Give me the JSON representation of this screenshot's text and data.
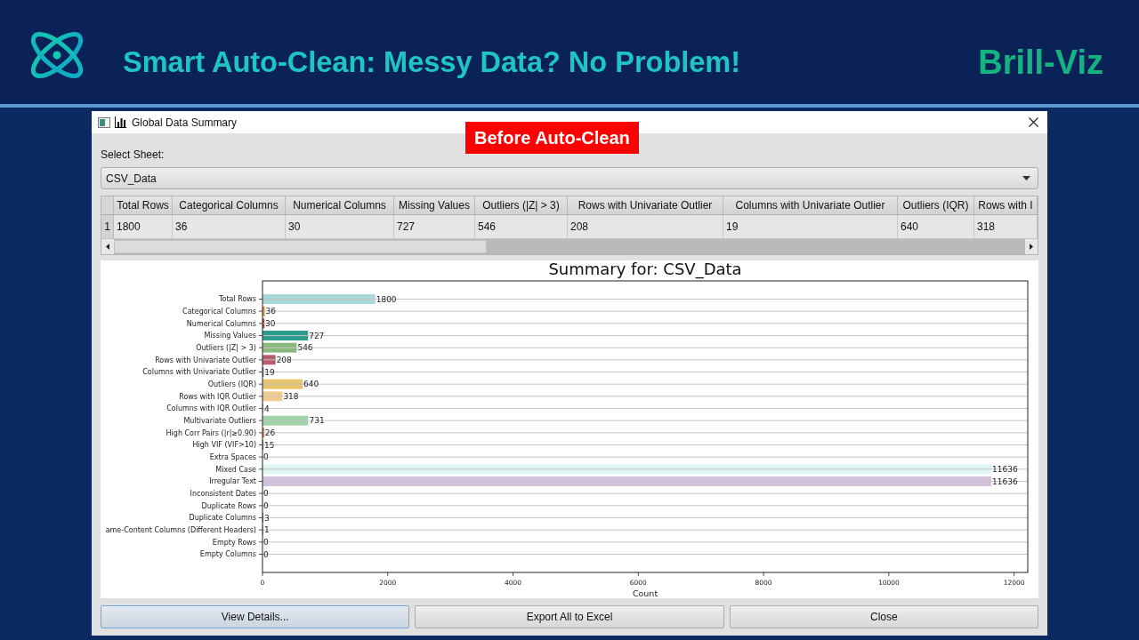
{
  "header": {
    "title": "Smart Auto-Clean: Messy Data? No Problem!",
    "brand": "Brill-Viz"
  },
  "badge": {
    "text": "Before Auto-Clean"
  },
  "dialog": {
    "title": "Global Data Summary",
    "sheet_label": "Select Sheet:",
    "sheet": {
      "value": "CSV_Data"
    },
    "table": {
      "columns": [
        "Total Rows",
        "Categorical Columns",
        "Numerical Columns",
        "Missing Values",
        "Outliers (|Z| > 3)",
        "Rows with Univariate Outlier",
        "Columns with Univariate Outlier",
        "Outliers (IQR)",
        "Rows with I"
      ],
      "rows": [
        {
          "header": "1",
          "cells": [
            "1800",
            "36",
            "30",
            "727",
            "546",
            "208",
            "19",
            "640",
            "318"
          ]
        }
      ]
    },
    "chart": {
      "chart_data": {
        "type": "bar",
        "orientation": "horizontal",
        "title": "Summary for: CSV_Data",
        "xlabel": "Count",
        "categories": [
          "Total Rows",
          "Categorical Columns",
          "Numerical Columns",
          "Missing Values",
          "Outliers (|Z| > 3)",
          "Rows with Univariate Outlier",
          "Columns with Univariate Outlier",
          "Outliers (IQR)",
          "Rows with IQR Outlier",
          "Columns with IQR Outlier",
          "Multivariate Outliers",
          "High Corr Pairs (|r|≥0.90)",
          "High VIF (VIF>10)",
          "Extra Spaces",
          "Mixed Case",
          "Irregular Text",
          "Inconsistent Dates",
          "Duplicate Rows",
          "Duplicate Columns",
          "ame-Content Columns (Different Headers)",
          "Empty Rows",
          "Empty Columns"
        ],
        "series": [
          {
            "values": [
              1800,
              36,
              30,
              727,
              546,
              208,
              19,
              640,
              318,
              4,
              731,
              26,
              15,
              0,
              11636,
              11636,
              0,
              0,
              3,
              1,
              0,
              0
            ]
          }
        ],
        "xlim": [
          0,
          12218
        ],
        "xticks": [
          0,
          2000,
          4000,
          6000,
          8000,
          10000,
          12000
        ],
        "grid": true,
        "data_labels": true
      }
    },
    "buttons": [
      {
        "label": "View Details...",
        "focused": true
      },
      {
        "label": "Export All to Excel",
        "focused": false
      },
      {
        "label": "Close",
        "focused": false
      }
    ]
  }
}
